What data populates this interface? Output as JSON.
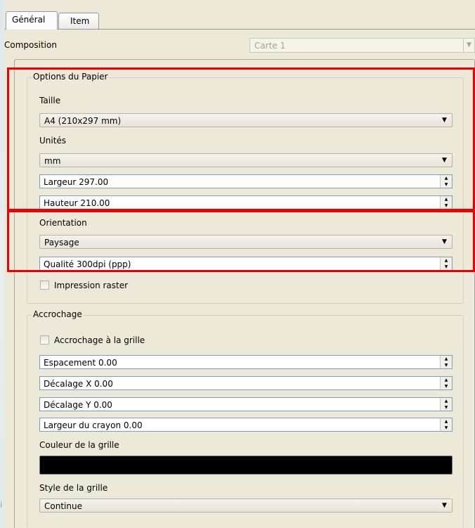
{
  "tabs": [
    {
      "label": "Général"
    },
    {
      "label": "Item"
    }
  ],
  "composition": {
    "label": "Composition",
    "value": "Carte 1"
  },
  "paper": {
    "group_title": "Options du Papier",
    "size_label": "Taille",
    "size_value": "A4 (210x297 mm)",
    "units_label": "Unités",
    "units_value": "mm",
    "width_value": "Largeur 297.00",
    "height_value": "Hauteur 210.00",
    "orientation_label": "Orientation",
    "orientation_value": "Paysage",
    "quality_value": "Qualité 300dpi (ppp)",
    "raster_label": "Impression raster"
  },
  "snap": {
    "group_title": "Accrochage",
    "snap_label": "Accrochage à la grille",
    "spacing_value": "Espacement 0.00",
    "offset_x_value": "Décalage X 0.00",
    "offset_y_value": "Décalage Y 0.00",
    "pen_width_value": "Largeur du crayon 0.00",
    "grid_color_label": "Couleur de la grille",
    "grid_color": "#000000",
    "grid_style_label": "Style de la grille",
    "grid_style_value": "Continue"
  },
  "side_fragment": "i",
  "highlight_color": "#ee0000"
}
